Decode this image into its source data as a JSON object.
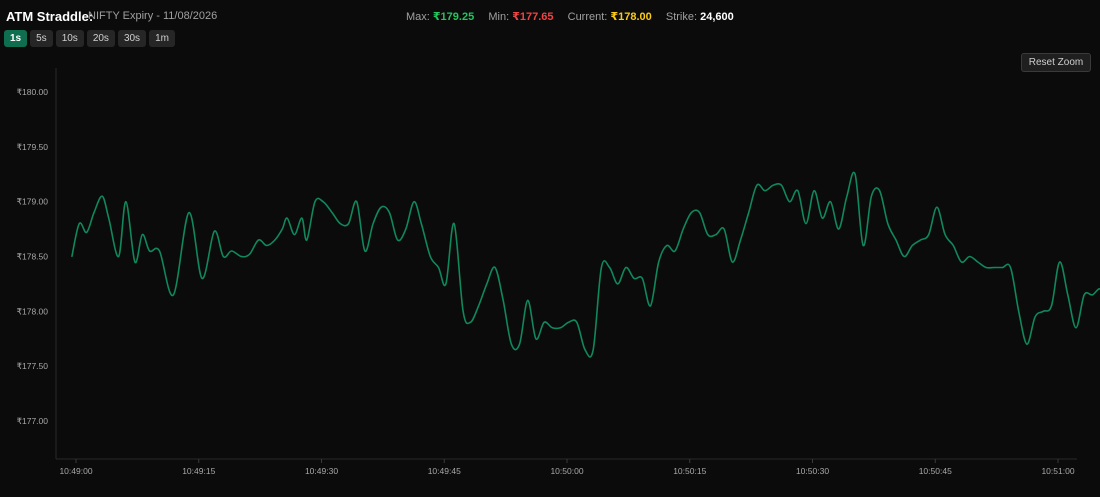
{
  "header": {
    "title": "ATM Straddle:",
    "subtitle": "NIFTY Expiry - 11/08/2026",
    "stats": {
      "max_label": "Max:",
      "max_value": "₹179.25",
      "min_label": "Min:",
      "min_value": "₹177.65",
      "current_label": "Current:",
      "current_value": "₹178.00",
      "strike_label": "Strike:",
      "strike_value": "24,600"
    }
  },
  "intervals": [
    {
      "label": "1s",
      "active": true
    },
    {
      "label": "5s",
      "active": false
    },
    {
      "label": "10s",
      "active": false
    },
    {
      "label": "20s",
      "active": false
    },
    {
      "label": "30s",
      "active": false
    },
    {
      "label": "1m",
      "active": false
    }
  ],
  "reset_zoom_label": "Reset Zoom",
  "colors": {
    "max": "#22c55e",
    "min": "#ef4444",
    "current": "#facc15",
    "strike": "#ffffff",
    "line": "#10885c",
    "active_interval": "#0f6e4f"
  },
  "chart_data": {
    "type": "line",
    "title": "",
    "xlabel": "",
    "ylabel": "",
    "ylim": [
      176.65,
      180.15
    ],
    "y_ticks": [
      "₹177.00",
      "₹177.50",
      "₹178.00",
      "₹178.50",
      "₹179.00",
      "₹179.50",
      "₹180.00"
    ],
    "y_tick_values": [
      177.0,
      177.5,
      178.0,
      178.5,
      179.0,
      179.5,
      180.0
    ],
    "x_ticks": [
      "10:49:00",
      "10:49:15",
      "10:49:30",
      "10:49:45",
      "10:50:00",
      "10:50:15",
      "10:50:30",
      "10:50:45",
      "10:51:00"
    ],
    "x_tick_values": [
      0,
      15,
      30,
      45,
      60,
      75,
      90,
      105,
      120
    ],
    "xlim": [
      -0.5,
      124.5
    ],
    "grid": false,
    "series": [
      {
        "values": [
          [
            -0.5,
            178.5
          ],
          [
            0.4,
            178.8
          ],
          [
            1.3,
            178.72
          ],
          [
            2.2,
            178.9
          ],
          [
            3.2,
            179.05
          ],
          [
            4.0,
            178.85
          ],
          [
            5.2,
            178.5
          ],
          [
            6.1,
            179.0
          ],
          [
            7.2,
            178.45
          ],
          [
            8.1,
            178.7
          ],
          [
            9.0,
            178.55
          ],
          [
            10.2,
            178.55
          ],
          [
            11.9,
            178.15
          ],
          [
            13.8,
            178.9
          ],
          [
            15.4,
            178.3
          ],
          [
            16.9,
            178.73
          ],
          [
            18.0,
            178.5
          ],
          [
            19.0,
            178.55
          ],
          [
            20.2,
            178.5
          ],
          [
            21.2,
            178.52
          ],
          [
            22.3,
            178.65
          ],
          [
            23.3,
            178.6
          ],
          [
            24.3,
            178.65
          ],
          [
            25.2,
            178.75
          ],
          [
            25.8,
            178.85
          ],
          [
            26.7,
            178.7
          ],
          [
            27.6,
            178.85
          ],
          [
            28.2,
            178.65
          ],
          [
            29.2,
            179.0
          ],
          [
            30.2,
            179.0
          ],
          [
            31.3,
            178.9
          ],
          [
            32.3,
            178.8
          ],
          [
            33.3,
            178.8
          ],
          [
            34.3,
            179.0
          ],
          [
            35.3,
            178.55
          ],
          [
            36.3,
            178.8
          ],
          [
            37.3,
            178.95
          ],
          [
            38.3,
            178.9
          ],
          [
            39.3,
            178.65
          ],
          [
            40.3,
            178.75
          ],
          [
            41.3,
            179.0
          ],
          [
            42.2,
            178.8
          ],
          [
            43.3,
            178.5
          ],
          [
            44.3,
            178.4
          ],
          [
            45.2,
            178.25
          ],
          [
            46.2,
            178.8
          ],
          [
            47.3,
            178.0
          ],
          [
            48.2,
            177.9
          ],
          [
            49.2,
            178.05
          ],
          [
            50.2,
            178.25
          ],
          [
            51.2,
            178.4
          ],
          [
            52.2,
            178.1
          ],
          [
            53.2,
            177.7
          ],
          [
            54.2,
            177.7
          ],
          [
            55.2,
            178.1
          ],
          [
            56.2,
            177.75
          ],
          [
            57.2,
            177.9
          ],
          [
            58.2,
            177.85
          ],
          [
            59.2,
            177.85
          ],
          [
            60.2,
            177.9
          ],
          [
            61.2,
            177.9
          ],
          [
            62.2,
            177.65
          ],
          [
            63.2,
            177.65
          ],
          [
            64.2,
            178.4
          ],
          [
            65.2,
            178.4
          ],
          [
            66.2,
            178.25
          ],
          [
            67.2,
            178.4
          ],
          [
            68.2,
            178.3
          ],
          [
            69.2,
            178.3
          ],
          [
            70.2,
            178.05
          ],
          [
            71.2,
            178.45
          ],
          [
            72.2,
            178.6
          ],
          [
            73.2,
            178.55
          ],
          [
            74.2,
            178.75
          ],
          [
            75.2,
            178.9
          ],
          [
            76.2,
            178.9
          ],
          [
            77.2,
            178.7
          ],
          [
            78.2,
            178.7
          ],
          [
            79.2,
            178.75
          ],
          [
            80.2,
            178.45
          ],
          [
            81.2,
            178.65
          ],
          [
            82.2,
            178.9
          ],
          [
            83.2,
            179.15
          ],
          [
            84.2,
            179.1
          ],
          [
            85.2,
            179.15
          ],
          [
            86.2,
            179.15
          ],
          [
            87.2,
            179.0
          ],
          [
            88.2,
            179.1
          ],
          [
            89.2,
            178.8
          ],
          [
            90.2,
            179.1
          ],
          [
            91.2,
            178.85
          ],
          [
            92.2,
            179.0
          ],
          [
            93.2,
            178.75
          ],
          [
            94.2,
            179.05
          ],
          [
            95.2,
            179.25
          ],
          [
            96.2,
            178.6
          ],
          [
            97.2,
            179.05
          ],
          [
            98.2,
            179.1
          ],
          [
            99.2,
            178.8
          ],
          [
            100.2,
            178.65
          ],
          [
            101.2,
            178.5
          ],
          [
            102.2,
            178.6
          ],
          [
            103.2,
            178.65
          ],
          [
            104.2,
            178.7
          ],
          [
            105.2,
            178.95
          ],
          [
            106.2,
            178.7
          ],
          [
            107.2,
            178.6
          ],
          [
            108.2,
            178.45
          ],
          [
            109.2,
            178.5
          ],
          [
            110.2,
            178.45
          ],
          [
            111.2,
            178.4
          ],
          [
            112.2,
            178.4
          ],
          [
            113.2,
            178.4
          ],
          [
            114.2,
            178.4
          ],
          [
            115.2,
            178.0
          ],
          [
            116.2,
            177.7
          ],
          [
            117.2,
            177.95
          ],
          [
            118.2,
            178.0
          ],
          [
            119.2,
            178.05
          ],
          [
            120.2,
            178.45
          ],
          [
            121.2,
            178.15
          ],
          [
            122.2,
            177.85
          ],
          [
            123.2,
            178.15
          ],
          [
            124.2,
            178.15
          ],
          [
            125.2,
            178.2
          ],
          [
            125.8,
            178.0
          ]
        ]
      }
    ]
  }
}
